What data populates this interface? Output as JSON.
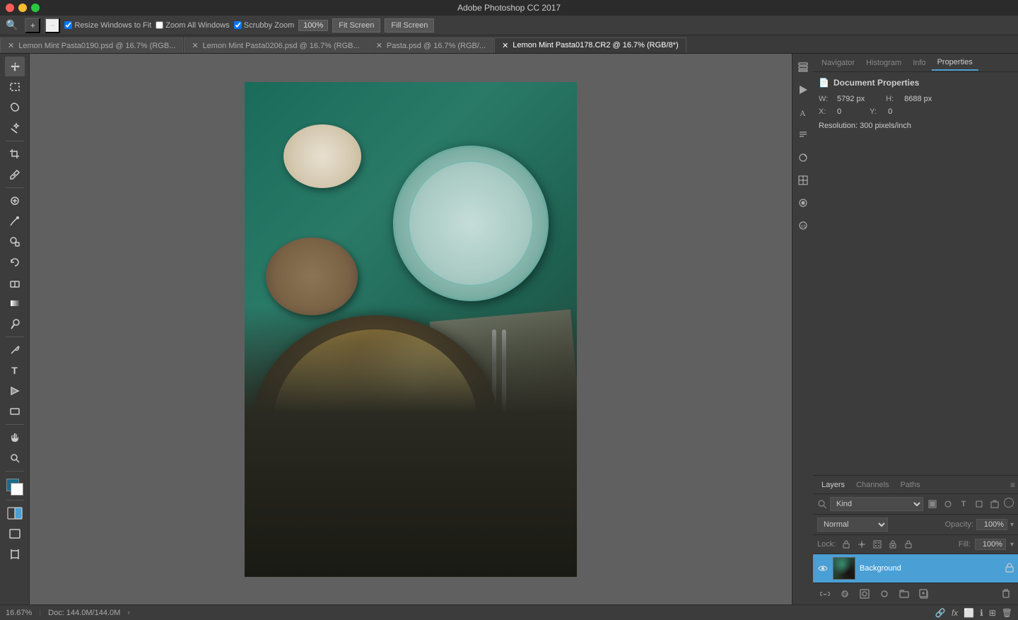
{
  "titleBar": {
    "title": "Adobe Photoshop CC 2017"
  },
  "optionsBar": {
    "zoomValue": "100%",
    "checkboxes": {
      "resizeWindows": "Resize Windows to Fit",
      "zoomAll": "Zoom All Windows",
      "scrubbyZoom": "Scrubby Zoom"
    },
    "buttons": {
      "fitScreen": "Fit Screen",
      "fillScreen": "Fill Screen"
    }
  },
  "tabs": [
    {
      "label": "Lemon Mint Pasta0190.psd @ 16.7% (RGB...",
      "active": false
    },
    {
      "label": "Lemon Mint Pasta0206.psd @ 16.7% (RGB...",
      "active": false
    },
    {
      "label": "Pasta.psd @ 16.7% (RGB/...",
      "active": false
    },
    {
      "label": "Lemon Mint Pasta0178.CR2 @ 16.7% (RGB/8*)",
      "active": true
    }
  ],
  "properties": {
    "panelTabs": [
      "Navigator",
      "Histogram",
      "Info",
      "Properties"
    ],
    "activeTab": "Properties",
    "sectionTitle": "Document Properties",
    "width": {
      "label": "W:",
      "value": "5792 px"
    },
    "height": {
      "label": "H:",
      "value": "8688 px"
    },
    "x": {
      "label": "X:",
      "value": "0"
    },
    "y": {
      "label": "Y:",
      "value": "0"
    },
    "resolution": "Resolution: 300 pixels/inch"
  },
  "layers": {
    "tabs": [
      "Layers",
      "Channels",
      "Paths"
    ],
    "activeTab": "Layers",
    "filterPlaceholder": "Kind",
    "blendMode": "Normal",
    "opacity": {
      "label": "Opacity:",
      "value": "100%"
    },
    "fill": {
      "label": "Fill:",
      "value": "100%"
    },
    "lock": {
      "label": "Lock:"
    },
    "items": [
      {
        "name": "Background",
        "visible": true,
        "locked": true
      }
    ]
  },
  "statusBar": {
    "zoom": "16.67%",
    "docInfo": "Doc: 144.0M/144.0M"
  },
  "icons": {
    "move": "✥",
    "marquee": "⬜",
    "lasso": "⭕",
    "wand": "⚡",
    "crop": "✂",
    "eyedropper": "💧",
    "spot": "🔵",
    "brush": "✏",
    "clone": "🔵",
    "eraser": "◻",
    "gradient": "▦",
    "dodge": "◯",
    "pen": "✒",
    "type": "T",
    "path": "▷",
    "shape": "⬛",
    "hand": "✋",
    "zoom": "🔍"
  }
}
